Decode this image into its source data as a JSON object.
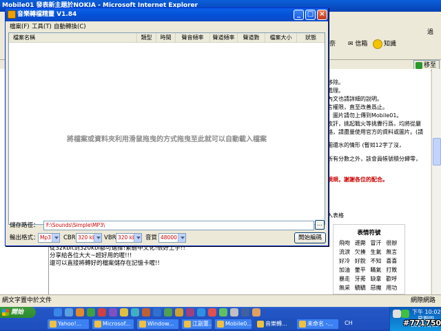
{
  "ie": {
    "title": "Mobile01 發表新主題於NOKIA - Microsoft Internet Explorer",
    "toolbar_right": [
      "奈",
      "信箱",
      "知識"
    ],
    "go_label": "移至",
    "status_left": "網文字置中於文件",
    "status_right": "網際網路",
    "right_edge": "過"
  },
  "article_lines": [
    "移除。",
    "處理。",
    "內文也請詳細的說明。",
    "言權限，直至改善爲止。",
    "：圖片請勿上傳到Mobile01。",
    "攻訐，挑起戰火等挑釁行爲，均將從嚴",
    "絡，請盡量使用官方的資料或圖片。(請",
    "圖還水的情形 (暫如12字了沒，",
    "所有分數之外，該會員帳號積分歸零，",
    "規規，謝謝各位的配合。"
  ],
  "side_label": "入表格",
  "emoticons": {
    "title": "表情符號",
    "items": [
      "飛吻",
      "遜斃",
      "冒汗",
      "很辦",
      "流淚",
      "欠揍",
      "生氣",
      "無言",
      "好冷",
      "好銳",
      "不知",
      "喜喜",
      "加油",
      "暈平",
      "瞞氣",
      "打敗",
      "暴走",
      "牙莠",
      "缺拿",
      "歡呼",
      "無采",
      "驕驕",
      "惡魔",
      "用功"
    ]
  },
  "forum_text": [
    "從32kbit到320kbi都可選擇!繁體中文化!很好上手!!",
    "分享給各位大大~超好用的喔!!!",
    "還可以直接將轉好的檔案儲存在記憶卡喔!!"
  ],
  "dialog": {
    "title": "音樂轉檔精靈 V1.84",
    "menu": [
      "檔案(F)",
      "工具(T)",
      "自動轉換(C)"
    ],
    "columns": [
      "檔案名稱",
      "類型",
      "時間",
      "聲音頻率",
      "聲道頻率",
      "聲道數",
      "檔案大小",
      "狀態"
    ],
    "drop_hint": "將檔案或資料夾利用滑鼠拖曳的方式拖曳至此就可以自動載入檔案",
    "save_label": "儲存路徑：",
    "save_path": "F:\\Sounds\\Simple\\MP3\\",
    "browse_label": "...",
    "format_label": "輸出格式：",
    "format_value": "Mp3",
    "cbr_label": "CBR",
    "cbr_value": "320 kbit",
    "vbr_label": "VBR",
    "vbr_value": "320 kbit",
    "freq_label": "音質",
    "freq_value": "48000 Hz",
    "start_label": "開始編碼"
  },
  "taskbar": {
    "start_label": "開始",
    "tasks": [
      "Yahoo!...",
      "Microsof...",
      "Window...",
      "江副董...",
      "Mobile0...",
      "音樂轉...",
      "未命名 -..."
    ],
    "ime": "CH",
    "clock_time": "下午 10:02",
    "clock_weekday": "星期四",
    "clock_date": "2007/1/25"
  },
  "watermark": "#771750"
}
